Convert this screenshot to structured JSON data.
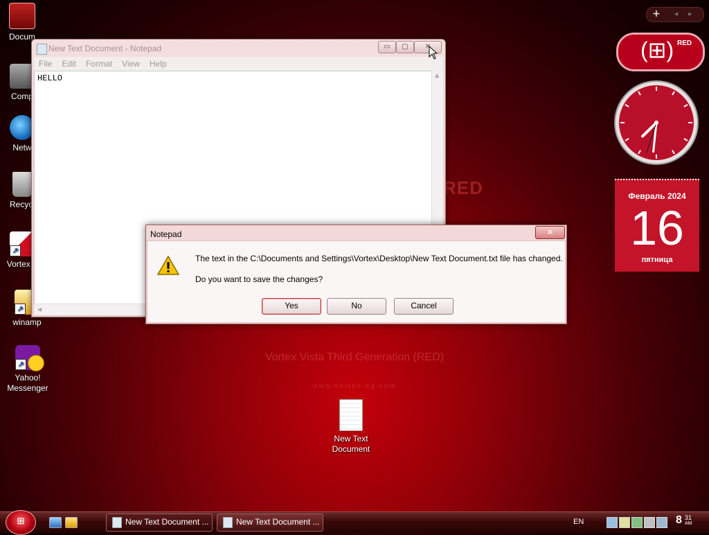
{
  "wallpaper": {
    "brand_title": "Vortex Vista Third Generation (RED)",
    "brand_url": "www.vortex-eg.com",
    "partial_text": "RED"
  },
  "desktop_icons": [
    {
      "label": "Docum",
      "icon": "documents-folder-icon"
    },
    {
      "label": "Comp",
      "icon": "computer-icon"
    },
    {
      "label": "Netw",
      "icon": "network-icon"
    },
    {
      "label": "Recycl",
      "icon": "recycle-bin-icon"
    },
    {
      "label": "Vortex T",
      "icon": "vortex-shortcut-icon"
    },
    {
      "label": "winamp",
      "icon": "winamp-icon"
    },
    {
      "label": "Yahoo! Messenger",
      "icon": "yahoo-messenger-icon"
    },
    {
      "label": "New Text Document",
      "icon": "text-file-icon"
    }
  ],
  "notepad": {
    "title": "New Text Document - Notepad",
    "menu": [
      "File",
      "Edit",
      "Format",
      "View",
      "Help"
    ],
    "content": "HELLO",
    "controls": {
      "minimize": "▭",
      "maximize": "▢",
      "close": "✕"
    }
  },
  "dialog": {
    "title": "Notepad",
    "close_label": "✕",
    "message": "The text in the C:\\Documents and Settings\\Vortex\\Desktop\\New Text Document.txt file has changed.",
    "question": "Do you want to save the changes?",
    "buttons": {
      "yes": "Yes",
      "no": "No",
      "cancel": "Cancel"
    }
  },
  "gadgets": {
    "toolbar": {
      "add": "+",
      "nav": "◂ ▸"
    },
    "logo": {
      "text": "RED"
    },
    "clock": {
      "hour": 7,
      "minute": 31,
      "second": 33
    },
    "calendar": {
      "month": "Февраль 2024",
      "day": "16",
      "weekday": "пятница"
    }
  },
  "taskbar": {
    "buttons": [
      {
        "label": "New Text Document ..."
      },
      {
        "label": "New Text Document ..."
      }
    ],
    "language": "EN",
    "clock": {
      "hour": "8",
      "minute": "31",
      "ampm": "AM"
    }
  },
  "colors": {
    "accent": "#c4142a",
    "dialog_bg": "#fbf6f6"
  }
}
